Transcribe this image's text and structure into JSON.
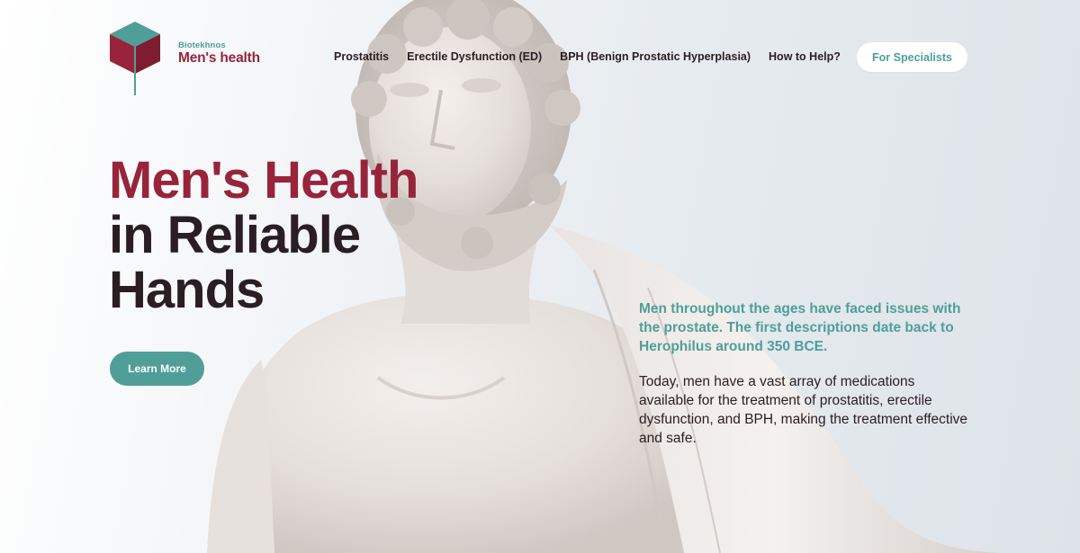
{
  "brand": {
    "company": "Biotekhnos",
    "product": "Men's health"
  },
  "nav": {
    "items": [
      {
        "label": "Prostatitis"
      },
      {
        "label": "Erectile Dysfunction (ED)"
      },
      {
        "label": "BPH (Benign Prostatic Hyperplasia)"
      },
      {
        "label": "How to Help?"
      }
    ],
    "specialists_button": "For Specialists"
  },
  "hero": {
    "title_line1": "Men's Health",
    "title_line2": "in Reliable",
    "title_line3": "Hands",
    "cta_label": "Learn More",
    "intro": "Men throughout the ages have faced issues with the prostate. The first descriptions date back to Herophilus around 350 BCE.",
    "body": "Today, men have a vast array of medications available for the treatment of prostatitis, erectile dysfunction, and BPH, making the treatment effective and safe."
  },
  "colors": {
    "accent_teal": "#4f9f98",
    "accent_crimson": "#97243b",
    "text_dark": "#2a1e22"
  }
}
